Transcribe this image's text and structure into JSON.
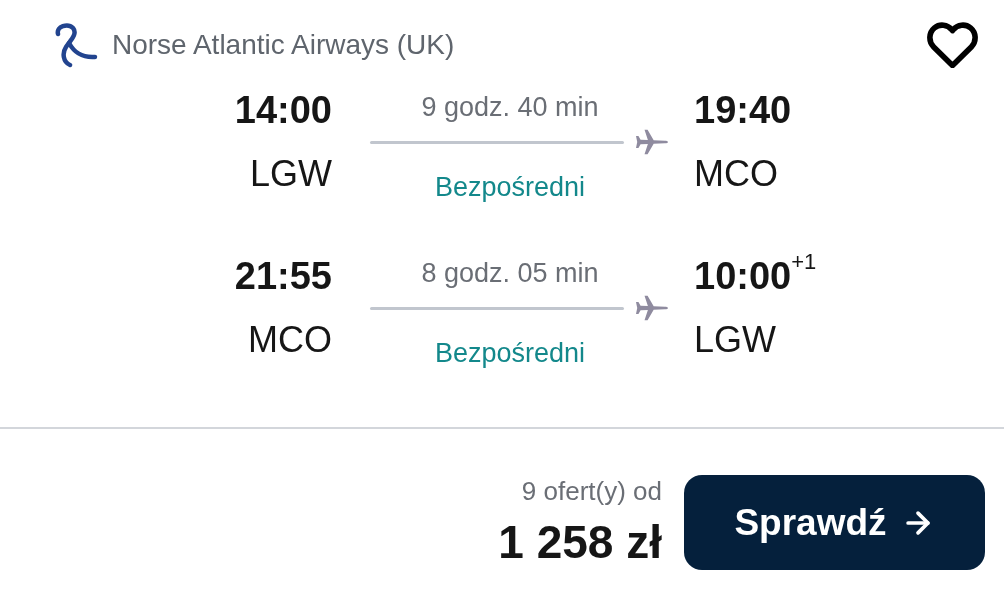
{
  "header": {
    "airline": "Norse Atlantic Airways (UK)",
    "saved": false
  },
  "legs": [
    {
      "depart_time": "14:00",
      "depart_airport": "LGW",
      "duration": "9 godz. 40 min",
      "stops": "Bezpośredni",
      "arrive_time": "19:40",
      "arrive_airport": "MCO"
    },
    {
      "depart_time": "21:55",
      "depart_airport": "MCO",
      "duration": "8 godz. 05 min",
      "stops": "Bezpośredni",
      "arrive_time": "10:00",
      "arrive_day_offset": "+1",
      "arrive_airport": "LGW"
    }
  ],
  "footer": {
    "offers": "9 ofert(y) od",
    "price": "1 258 zł",
    "button": "Sprawdź"
  }
}
